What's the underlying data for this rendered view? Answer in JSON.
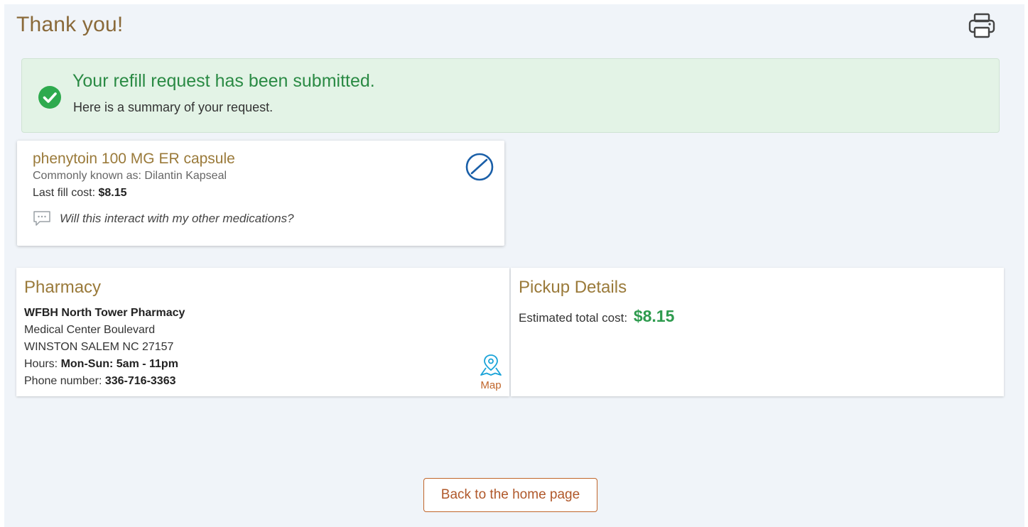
{
  "header": {
    "title": "Thank you!",
    "print_icon": "printer-icon"
  },
  "banner": {
    "icon": "check-circle-icon",
    "headline": "Your refill request has been submitted.",
    "subtext": "Here is a summary of your request."
  },
  "medication": {
    "name": "phenytoin 100 MG ER capsule",
    "aka_label": "Commonly known as:",
    "aka_value": "Dilantin Kapseal",
    "cost_label": "Last fill cost:",
    "cost_value": "$8.15",
    "icon": "pill-icon",
    "interaction_icon": "chat-bubble-icon",
    "interaction_link": "Will this interact with my other medications?"
  },
  "pharmacy": {
    "title": "Pharmacy",
    "name": "WFBH North Tower Pharmacy",
    "address1": "Medical Center Boulevard",
    "address2": "WINSTON SALEM NC 27157",
    "hours_label": "Hours:",
    "hours_value": "Mon-Sun: 5am - 11pm",
    "phone_label": "Phone number:",
    "phone_value": "336-716-3363",
    "map_icon": "map-pin-icon",
    "map_label": "Map"
  },
  "pickup": {
    "title": "Pickup Details",
    "est_label": "Estimated total cost:",
    "est_value": "$8.15"
  },
  "footer": {
    "home_button": "Back to the home page"
  },
  "colors": {
    "accent_gold": "#9a7a3a",
    "success_green": "#2a8a44",
    "banner_bg": "#e3f3e6",
    "link_orange": "#c0652a",
    "icon_blue": "#1a5fa8",
    "page_bg": "#f0f4f9"
  }
}
